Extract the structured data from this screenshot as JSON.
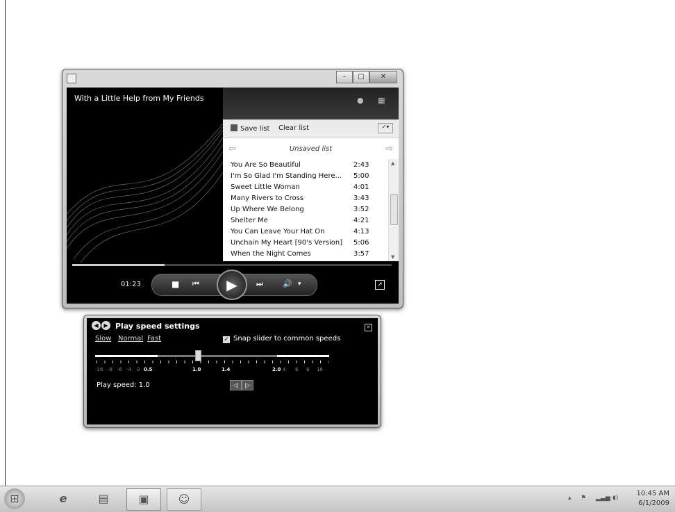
{
  "player": {
    "now_playing": "With a Little Help from My Friends",
    "playlist": {
      "save_label": "Save list",
      "clear_label": "Clear list",
      "title": "Unsaved list",
      "tracks": [
        {
          "name": "You Are So Beautiful",
          "duration": "2:43"
        },
        {
          "name": "I'm So Glad I'm Standing Here...",
          "duration": "5:00"
        },
        {
          "name": "Sweet Little Woman",
          "duration": "4:01"
        },
        {
          "name": "Many Rivers to Cross",
          "duration": "3:43"
        },
        {
          "name": "Up Where We Belong",
          "duration": "3:52"
        },
        {
          "name": "Shelter Me",
          "duration": "4:21"
        },
        {
          "name": "You Can Leave Your Hat On",
          "duration": "4:13"
        },
        {
          "name": "Unchain My Heart [90's Version]",
          "duration": "5:06"
        },
        {
          "name": "When the Night Comes",
          "duration": "3:57"
        }
      ]
    },
    "elapsed": "01:23",
    "seek_progress": 0.29
  },
  "speed": {
    "title": "Play speed settings",
    "presets": [
      "Slow",
      "Normal",
      "Fast"
    ],
    "snap_label": "Snap slider to common speeds",
    "snap_checked": true,
    "scale_labels": [
      "-16",
      "-8",
      "-6",
      "-4",
      "0",
      "0.5",
      "1.0",
      "1.4",
      "2.0",
      "4",
      "6",
      "8",
      "16"
    ],
    "current_text": "Play speed: 1.0",
    "current_value": 1.0
  },
  "taskbar": {
    "time": "10:45 AM",
    "date": "6/1/2009"
  }
}
